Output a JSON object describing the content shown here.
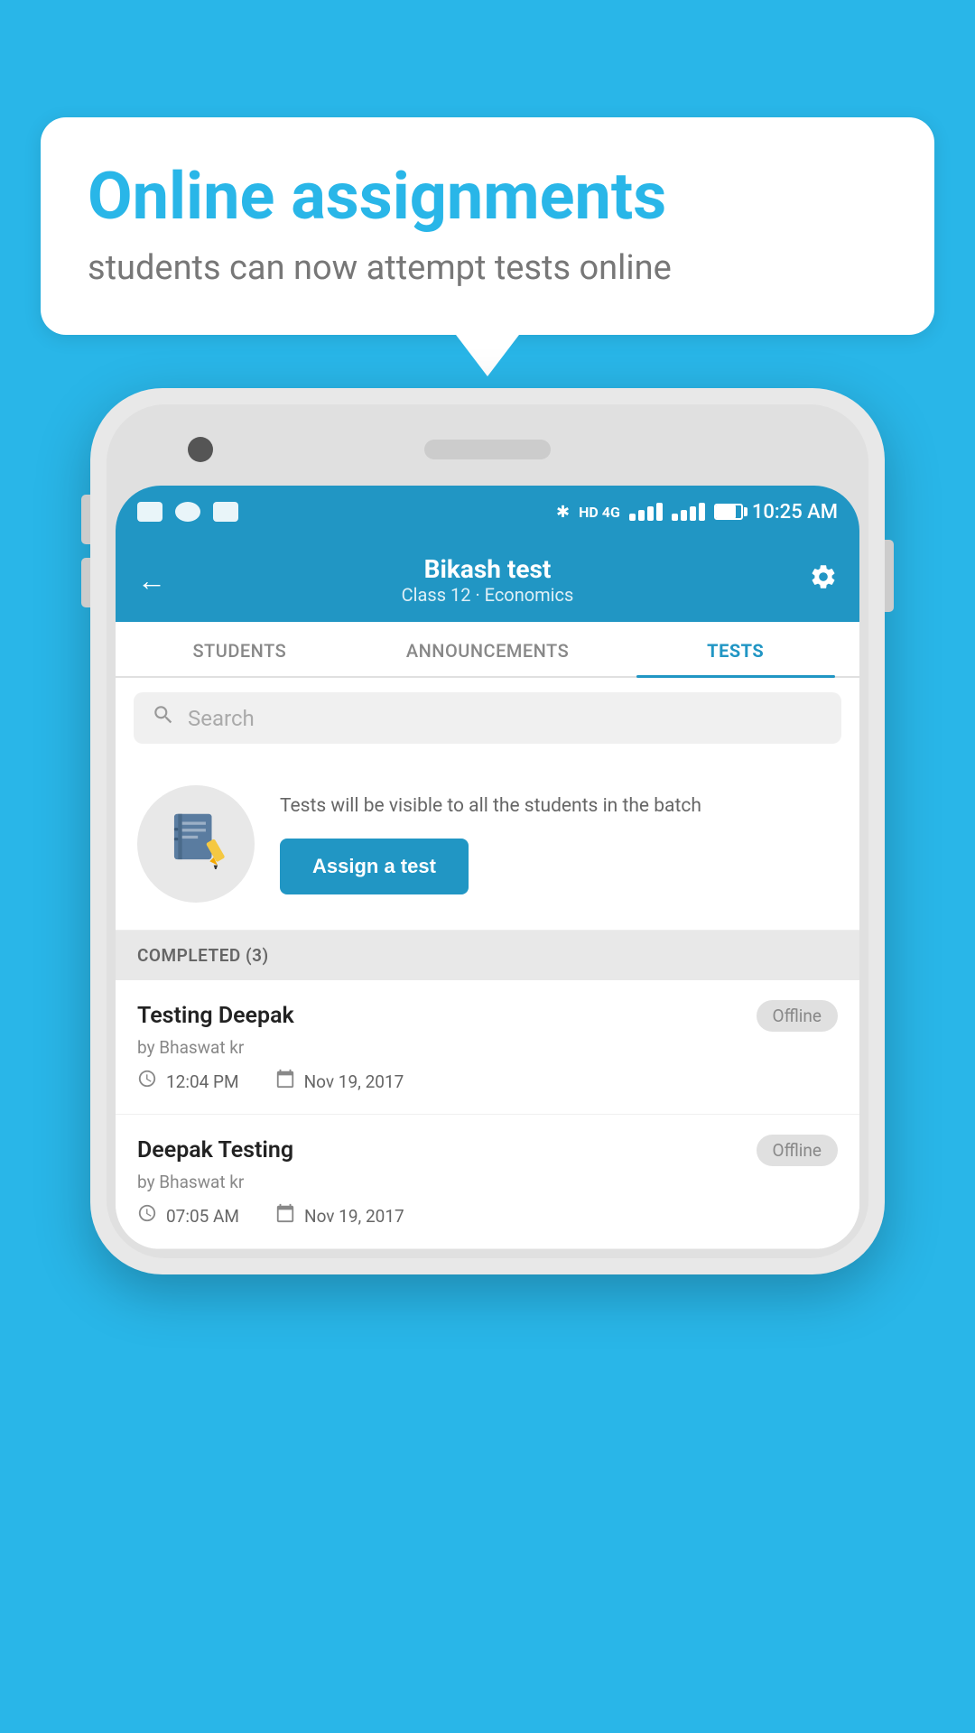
{
  "page": {
    "background_color": "#29b6e8"
  },
  "bubble": {
    "title": "Online assignments",
    "subtitle": "students can now attempt tests online"
  },
  "status_bar": {
    "time": "10:25 AM",
    "network": "HD 4G"
  },
  "app_bar": {
    "title": "Bikash test",
    "subtitle": "Class 12 · Economics",
    "back_label": "←"
  },
  "tabs": [
    {
      "label": "STUDENTS",
      "active": false
    },
    {
      "label": "ANNOUNCEMENTS",
      "active": false
    },
    {
      "label": "TESTS",
      "active": true
    }
  ],
  "search": {
    "placeholder": "Search"
  },
  "assign_section": {
    "description": "Tests will be visible to all the students in the batch",
    "button_label": "Assign a test"
  },
  "completed": {
    "header": "COMPLETED (3)",
    "items": [
      {
        "title": "Testing Deepak",
        "author": "by Bhaswat kr",
        "time": "12:04 PM",
        "date": "Nov 19, 2017",
        "badge": "Offline"
      },
      {
        "title": "Deepak Testing",
        "author": "by Bhaswat kr",
        "time": "07:05 AM",
        "date": "Nov 19, 2017",
        "badge": "Offline"
      }
    ]
  }
}
